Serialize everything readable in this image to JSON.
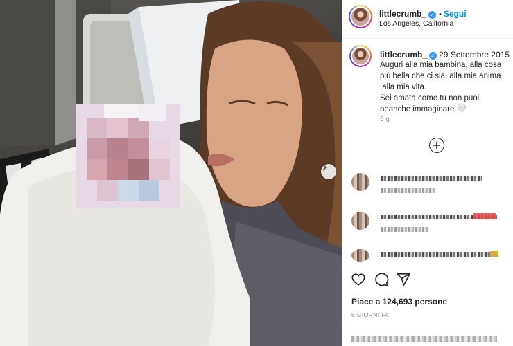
{
  "post": {
    "next_label": "›"
  },
  "header": {
    "username": "littlecrumb_",
    "dot": "•",
    "follow_label": "Segui",
    "location": "Los Angeles, California"
  },
  "caption": {
    "username": "littlecrumb_",
    "date": "29 Settembre 2015",
    "text": "Auguri alla mia bambina, alla cosa più bella che ci sia, alla mia anima ,alla mia vita.\nSei amata come tu non puoi neanche immaginare 🤍",
    "age": "5 g"
  },
  "actions": {
    "icons": [
      "heart-icon",
      "comment-icon",
      "share-icon"
    ],
    "likes": "Piace a 124,693 persone",
    "time_ago": "5 GIORNI FA"
  },
  "colors": {
    "accent": "#0095f6",
    "verified": "#3897f0",
    "text": "#262626",
    "muted": "#8e8e8e"
  }
}
